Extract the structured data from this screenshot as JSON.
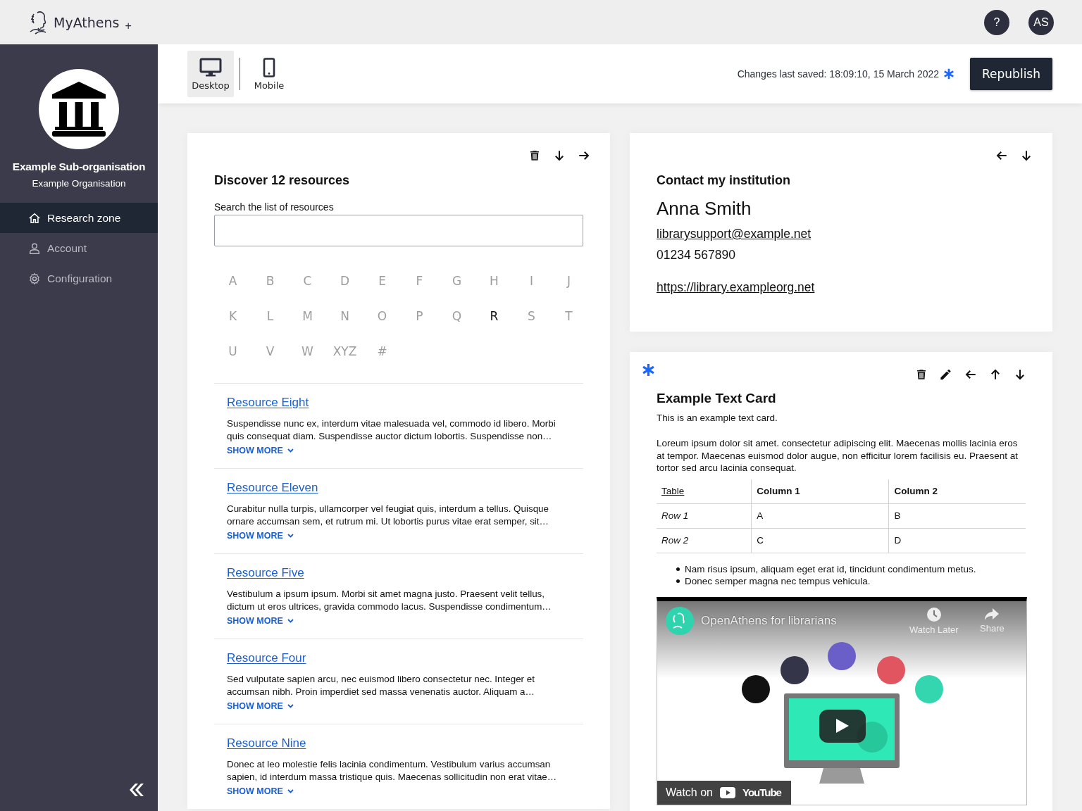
{
  "app": {
    "name": "MyAthens",
    "mark": "+"
  },
  "header": {
    "help": "?",
    "avatar": "AS"
  },
  "sidebar": {
    "org_name": "Example Sub-organisation",
    "parent_org": "Example Organisation",
    "items": [
      {
        "label": "Research zone",
        "selected": true
      },
      {
        "label": "Account",
        "selected": false
      },
      {
        "label": "Configuration",
        "selected": false
      }
    ]
  },
  "toolbar": {
    "views": [
      {
        "label": "Desktop",
        "selected": true
      },
      {
        "label": "Mobile",
        "selected": false
      }
    ],
    "saved_status": "Changes last saved: 18:09:10, 15 March 2022",
    "unsaved": true,
    "publish_button": "Republish"
  },
  "discover_card": {
    "title": "Discover 12 resources",
    "search_label": "Search the list of resources",
    "letters": [
      {
        "label": "A",
        "disabled": true
      },
      {
        "label": "B",
        "disabled": true
      },
      {
        "label": "C",
        "disabled": true
      },
      {
        "label": "D",
        "disabled": true
      },
      {
        "label": "E",
        "disabled": true
      },
      {
        "label": "F",
        "disabled": true
      },
      {
        "label": "G",
        "disabled": true
      },
      {
        "label": "H",
        "disabled": true
      },
      {
        "label": "I",
        "disabled": true
      },
      {
        "label": "J",
        "disabled": true
      },
      {
        "label": "K",
        "disabled": true
      },
      {
        "label": "L",
        "disabled": true
      },
      {
        "label": "M",
        "disabled": true
      },
      {
        "label": "N",
        "disabled": true
      },
      {
        "label": "O",
        "disabled": true
      },
      {
        "label": "P",
        "disabled": true
      },
      {
        "label": "Q",
        "disabled": true
      },
      {
        "label": "R",
        "disabled": false
      },
      {
        "label": "S",
        "disabled": true
      },
      {
        "label": "T",
        "disabled": true
      },
      {
        "label": "U",
        "disabled": true
      },
      {
        "label": "V",
        "disabled": true
      },
      {
        "label": "W",
        "disabled": true
      },
      {
        "label": "XYZ",
        "disabled": true
      },
      {
        "label": "#",
        "disabled": true
      }
    ],
    "resources": [
      {
        "title": "Resource Eight",
        "description": "Suspendisse nunc ex, interdum vitae malesuada vel, commodo id libero. Morbi quis consequat diam. Suspendisse auctor dictum lobortis. Suspendisse non…",
        "show_more": "SHOW MORE"
      },
      {
        "title": "Resource Eleven",
        "description": "Curabitur nulla turpis, ullamcorper vel feugiat quis, interdum a tellus. Quisque ornare accumsan sem, et rutrum mi. Ut lobortis purus vitae erat semper, sit…",
        "show_more": "SHOW MORE"
      },
      {
        "title": "Resource Five",
        "description": "Vestibulum a ipsum ipsum. Morbi sit amet magna justo. Praesent velit tellus, dictum ut eros ultrices, gravida commodo lacus. Suspendisse condimentum…",
        "show_more": "SHOW MORE"
      },
      {
        "title": "Resource Four",
        "description": "Sed vulputate sapien arcu, nec euismod libero consectetur nec. Integer et accumsan nibh. Proin imperdiet sed massa venenatis auctor. Aliquam a…",
        "show_more": "SHOW MORE"
      },
      {
        "title": "Resource Nine",
        "description": "Donec at leo molestie felis lacinia condimentum. Vestibulum varius accumsan sapien, id interdum massa tristique quis. Maecenas sollicitudin non erat vitae…",
        "show_more": "SHOW MORE"
      }
    ]
  },
  "contact_card": {
    "title": "Contact my institution",
    "name": "Anna Smith",
    "email": "librarysupport@example.net",
    "phone": "01234 567890",
    "website": "https://library.exampleorg.net"
  },
  "text_card": {
    "unsaved": true,
    "title": "Example Text Card",
    "intro": "This is an example text card.",
    "paragraph": "Loreum ipsum dolor sit amet. consectetur adipiscing elit. Maecenas mollis lacinia eros at tempor. Maecenas euismod dolor augue, non efficitur lorem facilisis eu. Praesent at tortor sed arcu lacinia consequat.",
    "table": {
      "columns": [
        "Table",
        "Column 1",
        "Column 2"
      ],
      "rows": [
        [
          "Row 1",
          "A",
          "B"
        ],
        [
          "Row 2",
          "C",
          "D"
        ]
      ]
    },
    "bullets": [
      "Nam risus ipsum, aliquam eget erat id, tincidunt condimentum metus.",
      "Donec semper magna nec tempus vehicula."
    ],
    "video": {
      "kind": "picture",
      "title": "OpenAthens for librarians",
      "watch_later": "Watch Later",
      "share": "Share",
      "watch_on": "Watch on",
      "brand": "YouTube"
    }
  }
}
